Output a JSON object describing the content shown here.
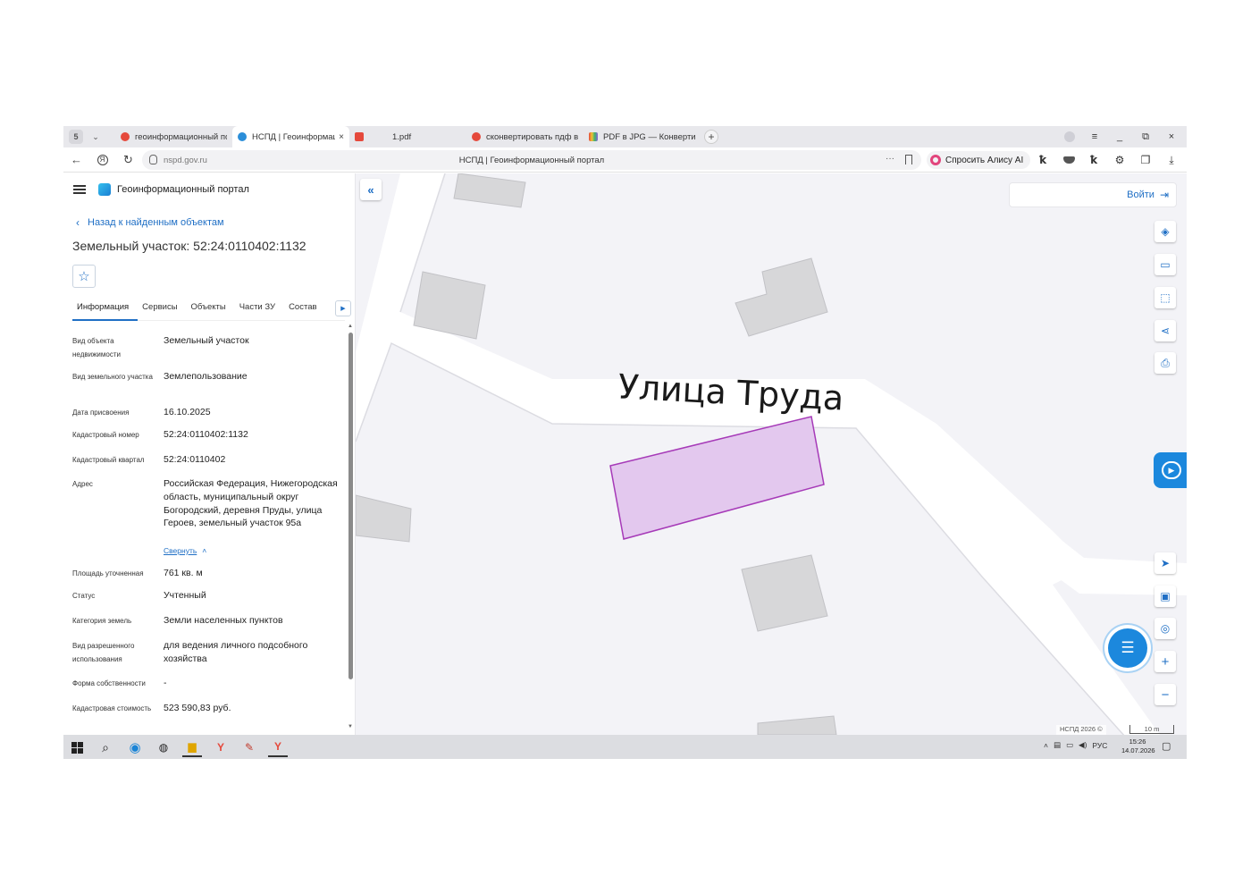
{
  "browser": {
    "tab_counter": "5",
    "tabs": [
      {
        "label": "геоинформационный по",
        "icon": "yandex-search-favicon",
        "color": "#e5493c",
        "active": false,
        "closable": false
      },
      {
        "label": "НСПД | Геоинформаци",
        "icon": "nspd-favicon",
        "color": "#2b8ed9",
        "active": true,
        "closable": true
      },
      {
        "label": "1.pdf",
        "icon": "pdf-favicon",
        "color": "#e5493c",
        "active": false,
        "closable": false
      },
      {
        "label": "сконвертировать пдф в jp",
        "icon": "yandex-search-favicon",
        "color": "#e5493c",
        "active": false,
        "closable": false
      },
      {
        "label": "PDF в JPG — Конвертиру",
        "icon": "converter-favicon",
        "color": "#8c63d6",
        "active": false,
        "closable": false
      }
    ],
    "new_tab": "+",
    "window_controls": {
      "menu": "≡",
      "minimize": "_",
      "restore": "⧉",
      "close": "×"
    },
    "url": "nspd.gov.ru",
    "page_title": "НСПД | Геоинформационный портал",
    "more": "···",
    "alice_label": "Спросить Алису AI"
  },
  "portal": {
    "name": "Геоинформационный портал",
    "back_label": "Назад к найденным объектам",
    "title": "Земельный участок: 52:24:0110402:1132",
    "tabs": [
      "Информация",
      "Сервисы",
      "Объекты",
      "Части ЗУ",
      "Состав"
    ],
    "properties": [
      {
        "label": "Вид объекта недвижимости",
        "value": "Земельный участок"
      },
      {
        "label": "Вид земельного участка",
        "value": "Землепользование"
      },
      {
        "label": "Дата присвоения",
        "value": "16.10.2025"
      },
      {
        "label": "Кадастровый номер",
        "value": "52:24:0110402:1132"
      },
      {
        "label": "Кадастровый квартал",
        "value": "52:24:0110402"
      },
      {
        "label": "Адрес",
        "value": "Российская Федерация, Нижегородская область, муниципальный округ Богородский, деревня Пруды, улица Героев, земельный участок 95а"
      },
      {
        "label": "Площадь уточненная",
        "value": "761 кв. м"
      },
      {
        "label": "Статус",
        "value": "Учтенный"
      },
      {
        "label": "Категория земель",
        "value": "Земли населенных пунктов"
      },
      {
        "label": "Вид разрешенного использования",
        "value": "для ведения личного подсобного хозяйства"
      },
      {
        "label": "Форма собственности",
        "value": "-"
      },
      {
        "label": "Кадастровая стоимость",
        "value": "523 590,83 руб."
      }
    ],
    "collapse_label": "Свернуть"
  },
  "map": {
    "street_label": "Улица Труда",
    "login_label": "Войти",
    "attribution": "НСПД 2026 ©",
    "scale_label": "10 m",
    "parcel_fill": "#e3c8ee",
    "parcel_stroke": "#a63ab8",
    "tools_top": [
      "layers-icon",
      "ruler-icon",
      "select-area-icon",
      "share-icon",
      "print-icon"
    ],
    "tools_bottom": [
      "locate-icon",
      "minimap-icon",
      "geo-search-icon",
      "zoom-in-icon",
      "zoom-out-icon"
    ]
  },
  "taskbar": {
    "language": "РУС",
    "time": "15:26",
    "date": "14.07.2026"
  },
  "colors": {
    "accent": "#1f6fc5",
    "chat": "#1c88dd"
  }
}
